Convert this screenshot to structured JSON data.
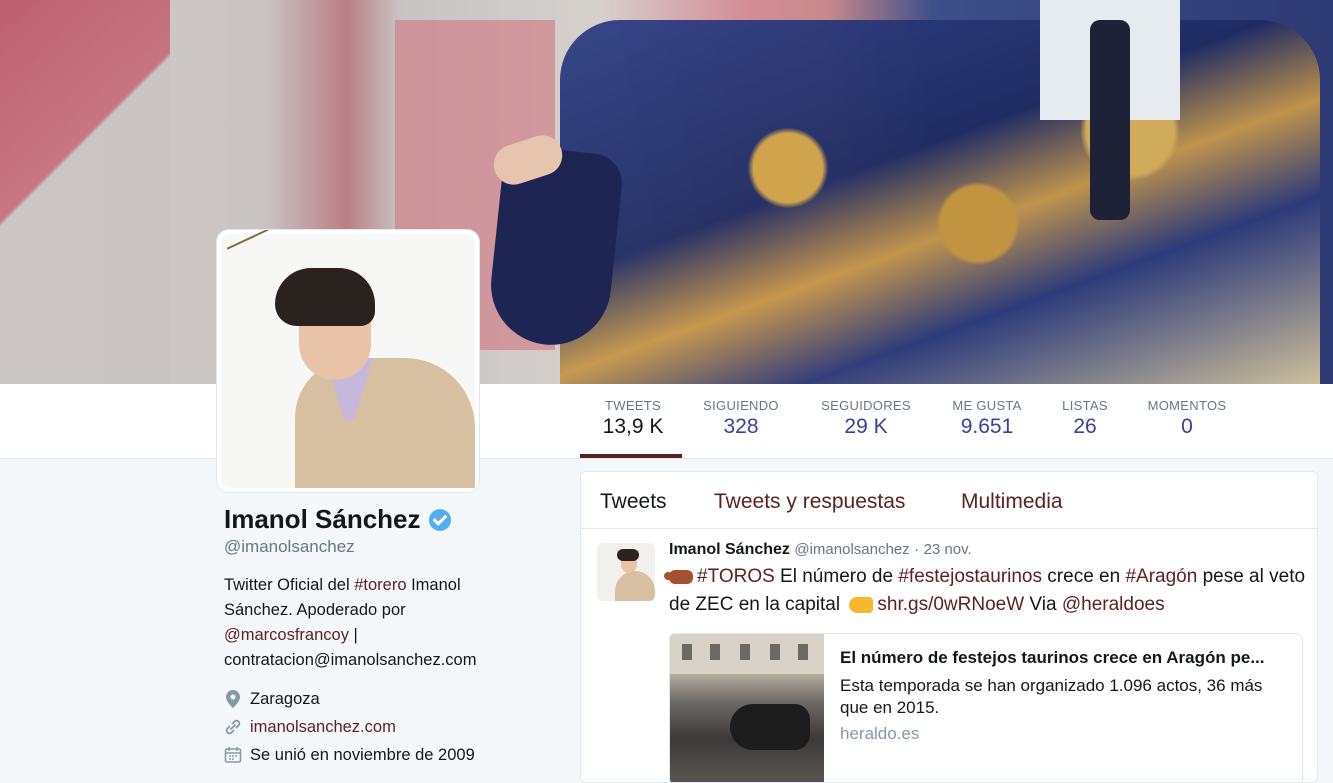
{
  "profile": {
    "name": "Imanol Sánchez",
    "handle": "@imanolsanchez",
    "bio_prefix": "Twitter Oficial del ",
    "bio_hashtag": "#torero",
    "bio_middle": " Imanol Sánchez. Apoderado por ",
    "bio_mention": "@marcosfrancoy",
    "bio_suffix": " | contratacion@imanolsanchez.com",
    "location": "Zaragoza",
    "website": "imanolsanchez.com",
    "joined": "Se unió en noviembre de 2009",
    "verified": true
  },
  "stats": [
    {
      "label": "TWEETS",
      "value": "13,9 K",
      "active": true
    },
    {
      "label": "SIGUIENDO",
      "value": "328"
    },
    {
      "label": "SEGUIDORES",
      "value": "29 K"
    },
    {
      "label": "ME GUSTA",
      "value": "9.651"
    },
    {
      "label": "LISTAS",
      "value": "26"
    },
    {
      "label": "MOMENTOS",
      "value": "0"
    }
  ],
  "tabs": [
    {
      "label": "Tweets",
      "active": true
    },
    {
      "label": "Tweets y respuestas"
    },
    {
      "label": "Multimedia"
    }
  ],
  "tweet": {
    "name": "Imanol Sánchez",
    "handle": "@imanolsanchez",
    "sep": "·",
    "date": "23 nov.",
    "t1": "#TOROS",
    "t2": " El número de ",
    "t3": "#festejostaurinos",
    "t4": " crece en ",
    "t5": "#Aragón",
    "t6": " pese al veto de ZEC en la capital ",
    "t7": "shr.gs/0wRNoeW",
    "t8": " Via ",
    "t9": "@heraldoes",
    "card": {
      "title": "El número de festejos taurinos crece en Aragón pe...",
      "description": "Esta temporada se han organizado 1.096 actos, 36 más que en 2015.",
      "domain": "heraldo.es"
    }
  },
  "colors": {
    "link": "#5c1f1f",
    "stat_value": "#3c3f99",
    "verified": "#55acee",
    "muted": "#657786"
  }
}
